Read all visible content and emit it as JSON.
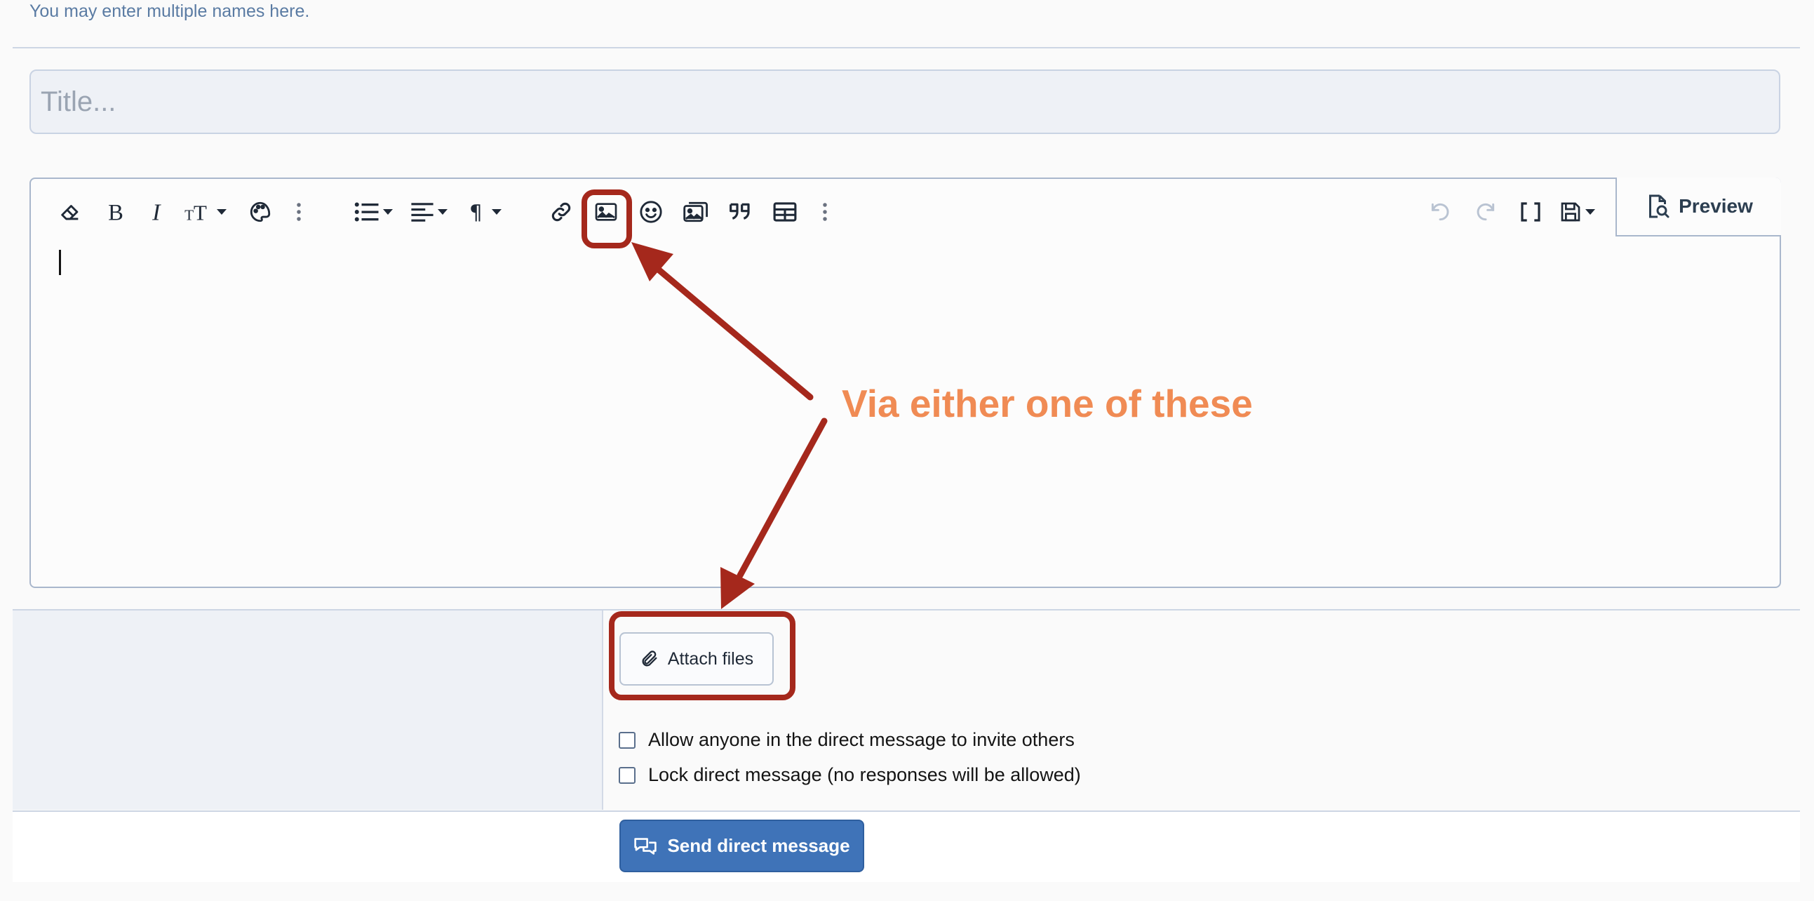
{
  "hint": "You may enter multiple names here.",
  "title_field": {
    "placeholder": "Title..."
  },
  "toolbar": {
    "preview_label": "Preview",
    "icons": [
      "eraser-icon",
      "bold-icon",
      "italic-icon",
      "font-size-icon",
      "palette-icon",
      "more-icon",
      "list-icon",
      "align-icon",
      "paragraph-icon",
      "link-icon",
      "image-icon",
      "smiley-icon",
      "media-icon",
      "quote-icon",
      "table-icon",
      "more-icon",
      "undo-icon",
      "redo-icon",
      "bbcode-icon",
      "save-draft-icon",
      "preview-icon"
    ]
  },
  "annotation": {
    "text": "Via either one of these",
    "color": "#f08b54",
    "highlight_color": "#a5281c"
  },
  "attach": {
    "label": "Attach files"
  },
  "options": [
    {
      "label": "Allow anyone in the direct message to invite others",
      "checked": false
    },
    {
      "label": "Lock direct message (no responses will be allowed)",
      "checked": false
    }
  ],
  "submit": {
    "label": "Send direct message"
  },
  "colors": {
    "accent": "#3f73b8",
    "hint": "#5a7ba3"
  }
}
